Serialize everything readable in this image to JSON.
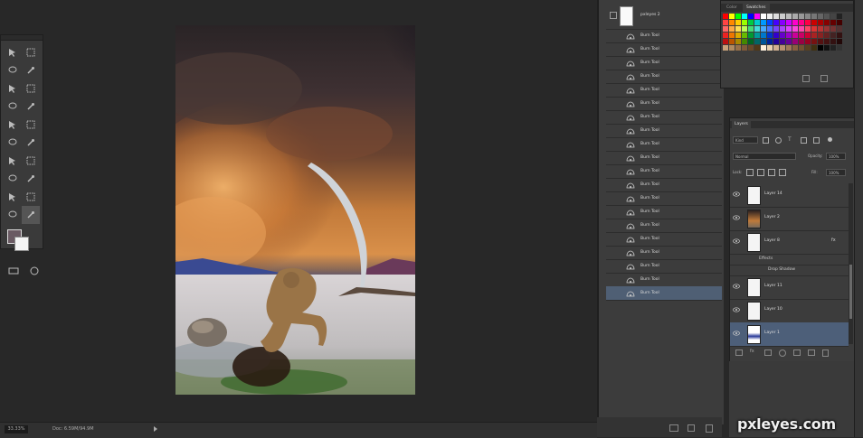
{
  "history": {
    "snapshot_label": "pxleyes 2",
    "step_label": "Burn Tool",
    "step_count": 20,
    "selected_index": 19
  },
  "swatches": {
    "tabs": [
      "Color",
      "Swatches"
    ],
    "active_tab": "Swatches"
  },
  "layers": {
    "tab": "Layers",
    "filter_kind": "Kind",
    "blend_mode": "Normal",
    "opacity_label": "Opacity:",
    "opacity_value": "100%",
    "lock_label": "Lock:",
    "fill_label": "Fill:",
    "fill_value": "100%",
    "items": [
      {
        "name": "Layer 14",
        "thumb": "white"
      },
      {
        "name": "Layer 2",
        "thumb": "photo"
      },
      {
        "name": "Layer 8",
        "thumb": "white",
        "fx": true
      },
      {
        "name": "Layer 11",
        "thumb": "white"
      },
      {
        "name": "Layer 10",
        "thumb": "white"
      },
      {
        "name": "Layer 1",
        "thumb": "blue",
        "selected": true
      }
    ],
    "effects_label": "Effects",
    "effect_name": "Drop Shadow"
  },
  "status": {
    "zoom": "33.33%",
    "doc_info": "Doc: 6.59M/94.9M"
  },
  "watermark": "pxleyes.com",
  "colors": {
    "panel_bg": "#3c3c3c",
    "app_bg": "#282828",
    "selected_row": "#4f5f74"
  }
}
